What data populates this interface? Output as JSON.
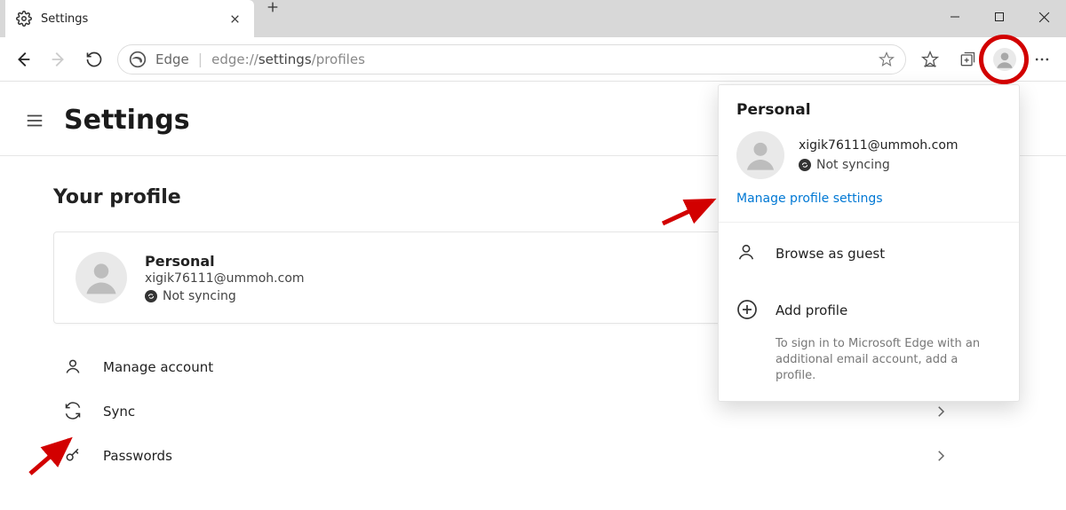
{
  "window_controls": {
    "minimize": "minimize",
    "maximize": "maximize",
    "close": "close"
  },
  "tab": {
    "title": "Settings"
  },
  "address": {
    "label": "Edge",
    "url_prefix": "edge://",
    "url_main": "settings",
    "url_suffix": "/profiles"
  },
  "page": {
    "title": "Settings",
    "section_title": "Your profile"
  },
  "profile_card": {
    "name": "Personal",
    "email": "xigik76111@ummoh.com",
    "sync_status": "Not syncing"
  },
  "menu": {
    "manage_account": "Manage account",
    "sync": "Sync",
    "passwords": "Passwords"
  },
  "popup": {
    "title": "Personal",
    "email": "xigik76111@ummoh.com",
    "sync_status": "Not syncing",
    "manage_link": "Manage profile settings",
    "browse_guest": "Browse as guest",
    "add_profile": "Add profile",
    "add_profile_desc": "To sign in to Microsoft Edge with an additional email account, add a profile."
  },
  "annotations": {
    "highlight": "profile-button",
    "arrows": [
      "manage-profile-settings",
      "sync-menu"
    ]
  }
}
